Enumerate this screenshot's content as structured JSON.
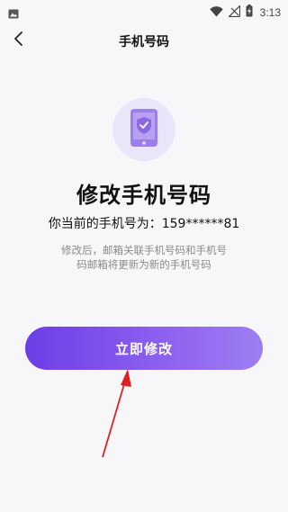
{
  "status_bar": {
    "time": "3:13",
    "icons": [
      "gallery-icon",
      "wifi-icon",
      "signal-off-icon",
      "battery-charging-icon"
    ]
  },
  "nav": {
    "title": "手机号码",
    "back_icon": "chevron-left-icon"
  },
  "hero": {
    "icon": "phone-shield-icon",
    "title": "修改手机号码",
    "current_phone": "你当前的手机号为：159******81",
    "note_line1": "修改后，邮箱关联手机号码和手机号",
    "note_line2": "码邮箱将更新为新的手机号码"
  },
  "actions": {
    "modify_label": "立即修改"
  },
  "annotation": {
    "type": "red-arrow-pointing-to-button",
    "color": "#e02020"
  },
  "colors": {
    "accent_start": "#6a3ee6",
    "accent_end": "#9d7ef2",
    "icon_bg": "#eae6fa",
    "icon_fill": "#9c7fec"
  }
}
